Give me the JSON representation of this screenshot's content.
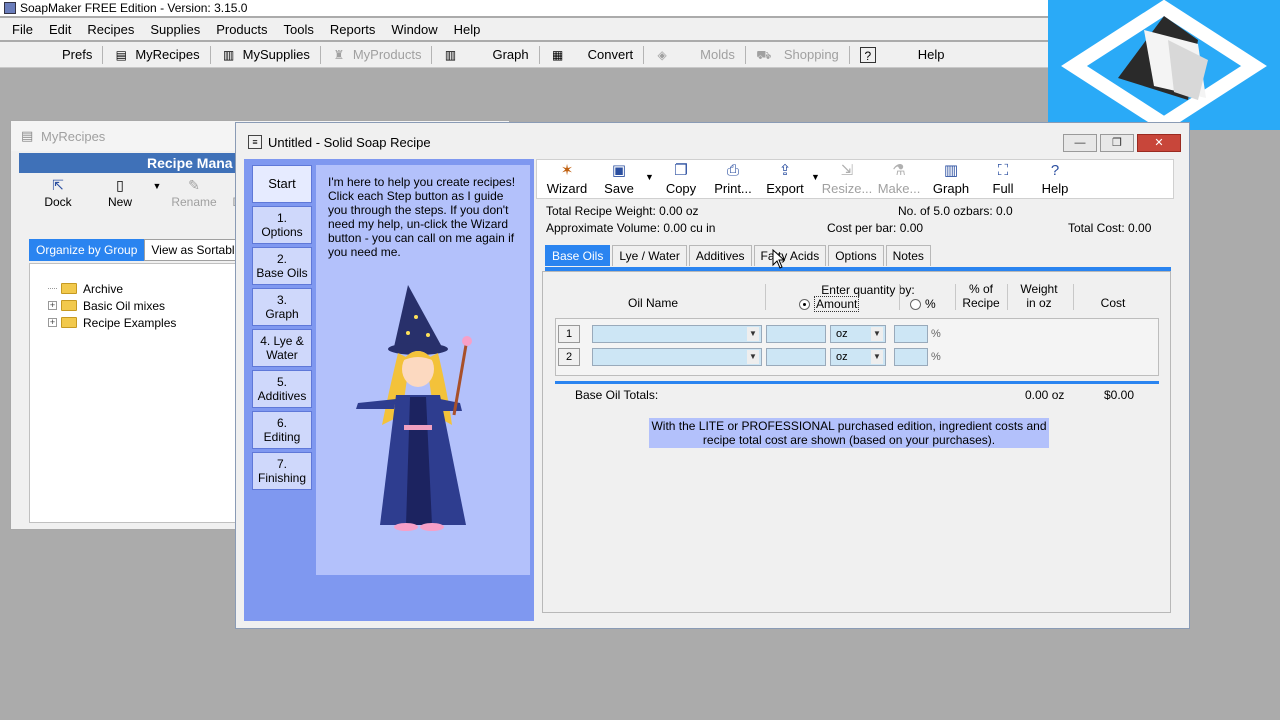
{
  "app": {
    "title": "SoapMaker FREE Edition - Version: 3.15.0",
    "menu": [
      "File",
      "Edit",
      "Recipes",
      "Supplies",
      "Products",
      "Tools",
      "Reports",
      "Window",
      "Help"
    ],
    "toolbar": {
      "prefs": "Prefs",
      "myrecipes": "MyRecipes",
      "mysupplies": "MySupplies",
      "myproducts": "MyProducts",
      "graph": "Graph",
      "convert": "Convert",
      "molds": "Molds",
      "shopping": "Shopping",
      "help": "Help"
    }
  },
  "myrecipes": {
    "title": "MyRecipes",
    "header": "Recipe Mana",
    "tools": {
      "dock": "Dock",
      "new": "New",
      "rename": "Rename",
      "delete": "De"
    },
    "tabs": {
      "group": "Organize by Group",
      "sortable": "View as Sortable"
    },
    "tree": [
      "Archive",
      "Basic Oil mixes",
      "Recipe Examples"
    ]
  },
  "recipe": {
    "title": "Untitled - Solid Soap Recipe",
    "wizard": {
      "steps": {
        "start": "Start",
        "s1a": "1.",
        "s1b": "Options",
        "s2a": "2.",
        "s2b": "Base Oils",
        "s3a": "3.",
        "s3b": "Graph",
        "s4a": "4. Lye &",
        "s4b": "Water",
        "s5a": "5.",
        "s5b": "Additives",
        "s6a": "6.",
        "s6b": "Editing",
        "s7a": "7.",
        "s7b": "Finishing"
      },
      "text": "I'm here to help you create recipes! Click each Step button as I guide you through the steps. If you don't need my help, un-click the Wizard button - you can call on me again if you need me."
    },
    "toolbar": {
      "wizard": "Wizard",
      "save": "Save",
      "copy": "Copy",
      "print": "Print...",
      "export": "Export",
      "resize": "Resize...",
      "make": "Make...",
      "graph": "Graph",
      "full": "Full",
      "help": "Help"
    },
    "info": {
      "total_weight": "Total Recipe Weight: 0.00 oz",
      "bars": "No. of 5.0 ozbars: 0.0",
      "volume": "Approximate Volume: 0.00 cu in",
      "cost_bar": "Cost per bar: 0.00",
      "total_cost": "Total Cost: 0.00"
    },
    "tabs": [
      "Base Oils",
      "Lye / Water",
      "Additives",
      "Fatty Acids",
      "Options",
      "Notes"
    ],
    "grid": {
      "oil_name": "Oil Name",
      "enter_qty": "Enter quantity by:",
      "amount": "Amount",
      "percent_radio": "%",
      "pct_recipe_1": "% of",
      "pct_recipe_2": "Recipe",
      "weight_1": "Weight",
      "weight_2": "in oz",
      "cost": "Cost",
      "rows": [
        {
          "n": "1",
          "unit": "oz",
          "pct": "%"
        },
        {
          "n": "2",
          "unit": "oz",
          "pct": "%"
        }
      ],
      "totals_label": "Base Oil Totals:",
      "totals_weight": "0.00 oz",
      "totals_cost": "$0.00",
      "notice": "With the LITE or PROFESSIONAL purchased edition, ingredient costs and recipe total cost are shown (based on your purchases)."
    }
  },
  "colors": {
    "accent": "#2a84f0",
    "wizard_bg": "#7f98f0",
    "wizard_text_bg": "#b3c1fb",
    "logo_bg": "#2aaaf7"
  }
}
